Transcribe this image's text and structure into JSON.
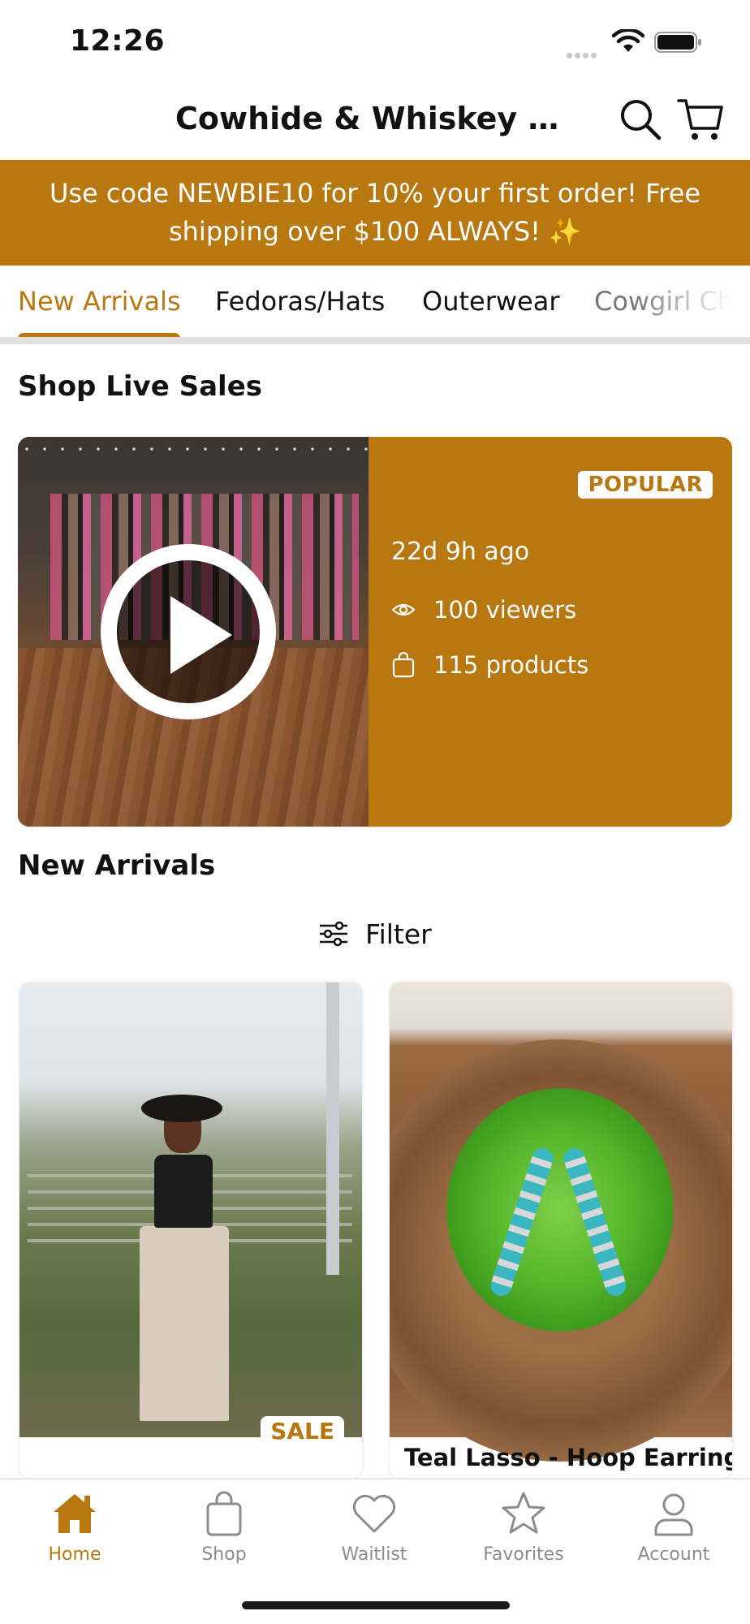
{
  "status_bar": {
    "time": "12:26"
  },
  "header": {
    "title": "Cowhide & Whiskey Bou..."
  },
  "promo": {
    "text": "Use code NEWBIE10 for 10% your first order! Free shipping over $100 ALWAYS! ✨"
  },
  "tabs": [
    {
      "label": "New Arrivals",
      "active": true
    },
    {
      "label": "Fedoras/Hats"
    },
    {
      "label": "Outerwear"
    },
    {
      "label": "Cowgirl Ch"
    }
  ],
  "live_sales": {
    "section_title": "Shop Live Sales",
    "badge": "POPULAR",
    "time_ago": "22d 9h ago",
    "viewers": "100 viewers",
    "products": "115 products"
  },
  "new_arrivals": {
    "section_title": "New Arrivals",
    "filter_label": "Filter",
    "products": [
      {
        "badge": "SALE",
        "title": ""
      },
      {
        "title": "Teal Lasso - Hoop Earrings"
      }
    ]
  },
  "tabbar": [
    {
      "label": "Home",
      "icon": "home-icon",
      "active": true
    },
    {
      "label": "Shop",
      "icon": "bag-icon"
    },
    {
      "label": "Waitlist",
      "icon": "heart-icon"
    },
    {
      "label": "Favorites",
      "icon": "star-icon"
    },
    {
      "label": "Account",
      "icon": "person-icon"
    }
  ],
  "colors": {
    "accent": "#b8770f",
    "inactive": "#8c8c8c"
  }
}
